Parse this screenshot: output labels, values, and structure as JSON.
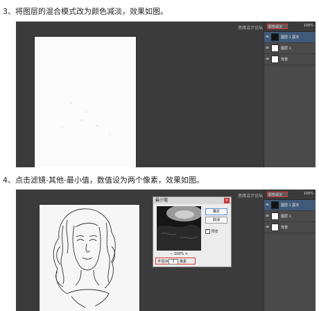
{
  "step3": {
    "text": "3、将图层的混合模式改为颜色减淡，效果如图。"
  },
  "step4": {
    "text": "4、点击滤镜-其他-最小值，数值设为两个像素，效果如图。"
  },
  "watermark": "思缘设计论坛",
  "screenshot1": {
    "blend_mode": "颜色减淡",
    "opacity": "100%",
    "layers": [
      {
        "name": "图层 1 副本",
        "thumb": "dark",
        "selected": true
      },
      {
        "name": "图层 1",
        "thumb": "light",
        "selected": false
      },
      {
        "name": "背景",
        "thumb": "light",
        "selected": false
      }
    ]
  },
  "screenshot2": {
    "blend_mode": "颜色减淡",
    "opacity": "100%",
    "layers": [
      {
        "name": "图层 1 副本",
        "thumb": "dark",
        "selected": true
      },
      {
        "name": "图层 1",
        "thumb": "light",
        "selected": false
      },
      {
        "name": "背景",
        "thumb": "light",
        "selected": false
      }
    ],
    "dialog": {
      "title": "最小值",
      "ok": "确定",
      "cancel": "取消",
      "preview_label": "预览",
      "zoom": "100%",
      "radius_label": "半径(R):",
      "radius_value": "2",
      "radius_unit": "像素"
    }
  },
  "colors": {
    "ps_dark": "#3b3b3b",
    "panel": "#4a4a4a",
    "highlight": "#dd3333",
    "selected_layer": "#3f5a7a"
  }
}
